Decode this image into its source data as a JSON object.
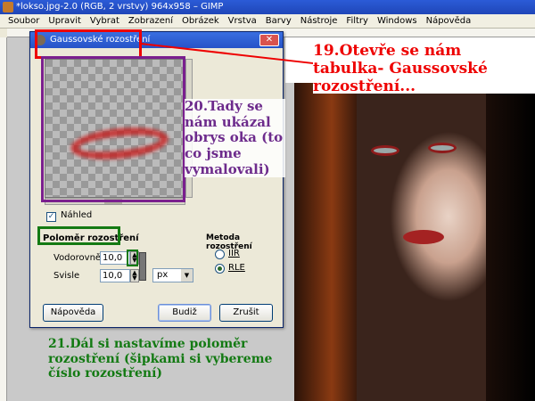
{
  "window": {
    "title": "*lokso.jpg-2.0 (RGB, 2 vrstvy) 964x958 – GIMP"
  },
  "menu": [
    "Soubor",
    "Upravit",
    "Vybrat",
    "Zobrazení",
    "Obrázek",
    "Vrstva",
    "Barvy",
    "Nástroje",
    "Filtry",
    "Windows",
    "Nápověda"
  ],
  "dialog": {
    "title": "Gaussovské rozostření",
    "close_glyph": "✕",
    "preview_label": "Náhled",
    "preview_checked": true,
    "radius_label": "Poloměr rozostření",
    "horizontal_label": "Vodorovně",
    "horizontal_value": "10,0",
    "vertical_label": "Svisle",
    "vertical_value": "10,0",
    "unit_value": "px",
    "method_label": "Metoda rozostření",
    "method_iir": "IIR",
    "method_rle": "RLE",
    "method_selected": "RLE",
    "help_button": "Nápověda",
    "ok_button": "Budiž",
    "cancel_button": "Zrušit"
  },
  "annotations": {
    "step19": "19.Otevře se nám tabulka- Gaussovské rozostření...",
    "step20": "20.Tady se nám ukázal obrys oka (to co jsme vymalovali)",
    "step21": "21.Dál si nastavíme poloměr rozostření (šipkami si vybereme číslo rozostření)"
  },
  "colors": {
    "annotation_red": "#e00000",
    "annotation_purple": "#6d2b8c",
    "annotation_green": "#137a13"
  }
}
